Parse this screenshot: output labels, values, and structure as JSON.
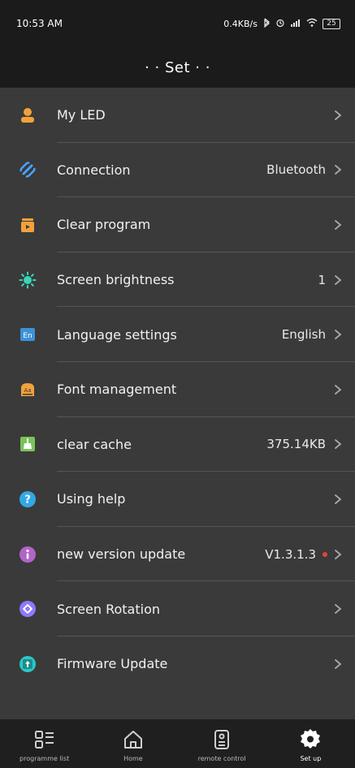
{
  "status_bar": {
    "time": "10:53 AM",
    "network_speed": "0.4KB/s",
    "icons": [
      "bluetooth-icon",
      "alarm-icon",
      "signal-icon",
      "wifi-icon",
      "battery-icon"
    ],
    "battery": "25"
  },
  "header": {
    "title": "· · Set · ·"
  },
  "settings": {
    "items": [
      {
        "label": "My LED",
        "value": "",
        "icon": "user-icon",
        "color": "#f2a23b"
      },
      {
        "label": "Connection",
        "value": "Bluetooth",
        "icon": "connection-icon",
        "color": "#4aa3ff"
      },
      {
        "label": "Clear program",
        "value": "",
        "icon": "trash-box-icon",
        "color": "#f2a23b"
      },
      {
        "label": "Screen brightness",
        "value": "1",
        "icon": "brightness-icon",
        "color": "#39d6b5"
      },
      {
        "label": "Language settings",
        "value": "English",
        "icon": "language-icon",
        "color": "#3d90d8"
      },
      {
        "label": "Font management",
        "value": "",
        "icon": "font-icon",
        "color": "#f2a23b"
      },
      {
        "label": "clear cache",
        "value": "375.14KB",
        "icon": "broom-icon",
        "color": "#78c45a"
      },
      {
        "label": "Using help",
        "value": "",
        "icon": "help-icon",
        "color": "#33a8e6"
      },
      {
        "label": "new version update",
        "value": "V1.3.1.3",
        "icon": "info-icon",
        "color": "#b165c8"
      },
      {
        "label": "Screen Rotation",
        "value": "",
        "icon": "rotation-icon",
        "color": "#8e79ff"
      },
      {
        "label": "Firmware Update",
        "value": "",
        "icon": "firmware-icon",
        "color": "#2cc7c7"
      }
    ]
  },
  "bottom_nav": {
    "items": [
      {
        "label": "programme list",
        "icon": "list-grid-icon",
        "active": false
      },
      {
        "label": "Home",
        "icon": "home-icon",
        "active": false
      },
      {
        "label": "remote control",
        "icon": "remote-icon",
        "active": false
      },
      {
        "label": "Set up",
        "icon": "gear-icon",
        "active": true
      }
    ]
  }
}
